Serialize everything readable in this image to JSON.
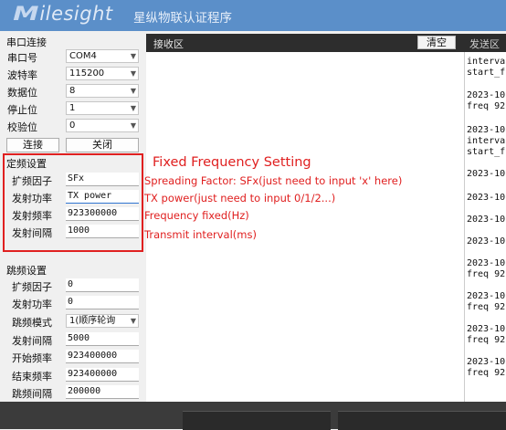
{
  "header": {
    "logo_mark": "M",
    "logo_text": "ilesight",
    "app_title": "星纵物联认证程序"
  },
  "serial": {
    "section_title": "串口连接",
    "rows": [
      {
        "label": "串口号",
        "value": "COM4"
      },
      {
        "label": "波特率",
        "value": "115200"
      },
      {
        "label": "数据位",
        "value": "8"
      },
      {
        "label": "停止位",
        "value": "1"
      },
      {
        "label": "校验位",
        "value": "0"
      }
    ],
    "connect_label": "连接",
    "close_label": "关闭"
  },
  "fixed": {
    "section_title": "定频设置",
    "rows": [
      {
        "label": "扩频因子",
        "value": "SFx"
      },
      {
        "label": "发射功率",
        "value": "TX power"
      },
      {
        "label": "发射频率",
        "value": "923300000"
      },
      {
        "label": "发射间隔",
        "value": "1000"
      }
    ]
  },
  "annotations": {
    "title": "Fixed Frequency Setting",
    "lines": [
      "Spreading Factor: SFx(just need to input 'x' here)",
      "TX power(just need to input 0/1/2...)",
      "Frequency fixed(Hz)",
      "Transmit interval(ms)"
    ]
  },
  "hopping": {
    "section_title": "跳频设置",
    "rows": [
      {
        "label": "扩频因子",
        "value": "0"
      },
      {
        "label": "发射功率",
        "value": "0"
      },
      {
        "label": "跳频模式",
        "value": "1(顺序轮询"
      },
      {
        "label": "发射间隔",
        "value": "5000"
      },
      {
        "label": "开始频率",
        "value": "923400000"
      },
      {
        "label": "结束频率",
        "value": "923400000"
      },
      {
        "label": "跳频间隔",
        "value": "200000"
      }
    ]
  },
  "receive": {
    "title": "接收区",
    "clear_label": "清空"
  },
  "send": {
    "title": "发送区"
  },
  "log": {
    "lines": [
      "interva",
      "start_f",
      "",
      "2023-10",
      "freq 92",
      "",
      "2023-10",
      "interva",
      "start_f",
      "",
      "2023-10",
      "",
      "2023-10",
      "",
      "2023-10",
      "",
      "2023-10",
      "",
      "2023-10",
      "freq 92",
      "",
      "2023-10",
      "freq 92",
      "",
      "2023-10",
      "freq 92",
      "",
      "2023-10",
      "freq 92"
    ]
  },
  "colors": {
    "header_bg": "#5b8fc9",
    "annotation": "#e02020",
    "dark_bar": "#2d2d2d"
  }
}
